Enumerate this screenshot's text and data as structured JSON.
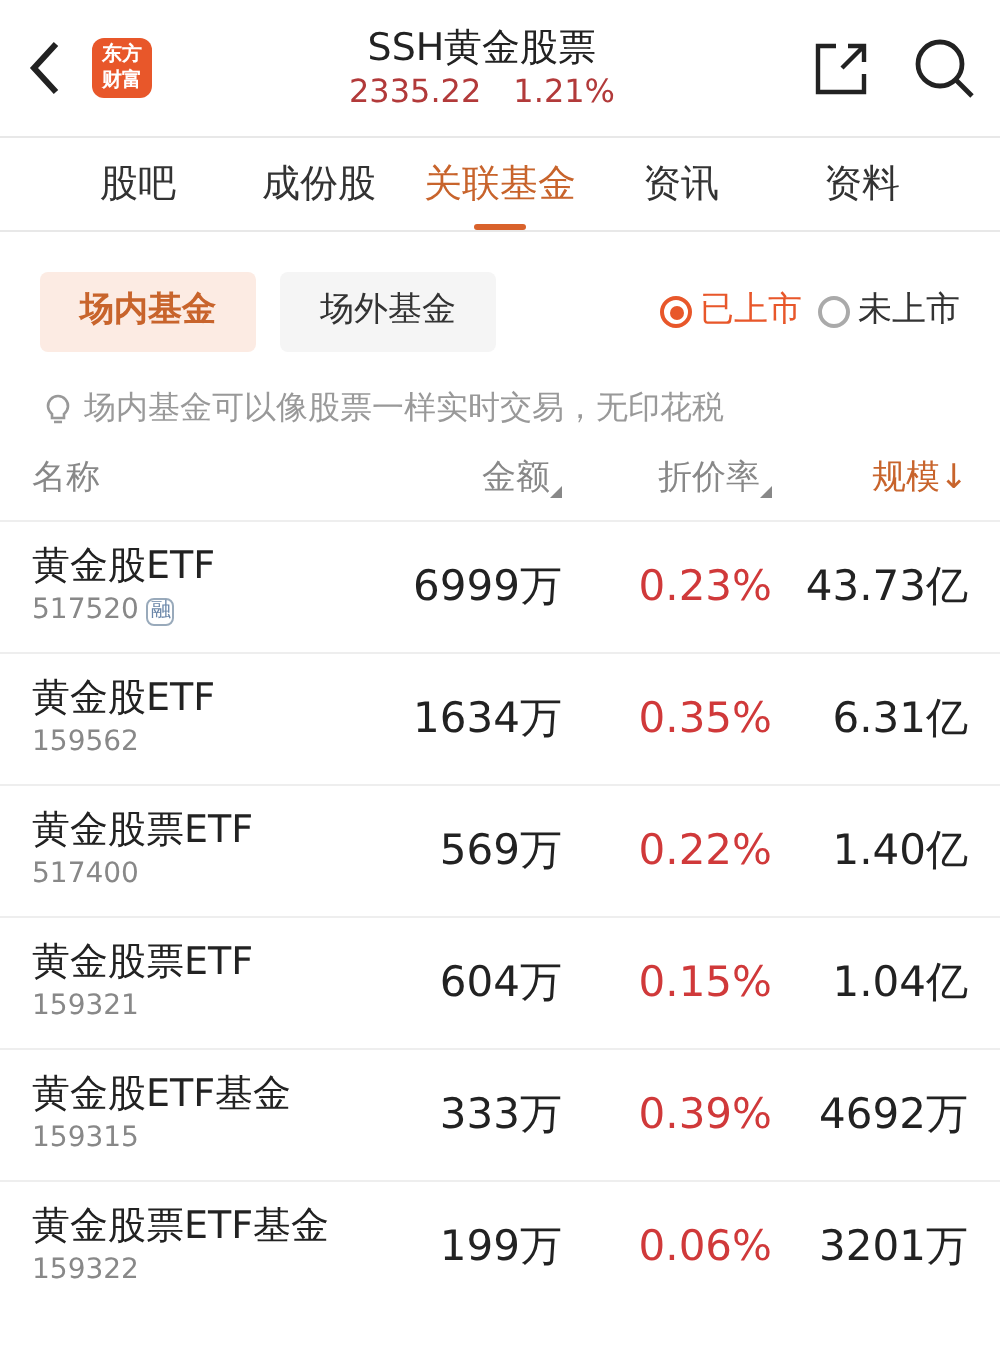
{
  "header": {
    "logo": [
      "东方",
      "财富"
    ],
    "title": "SSH黄金股票",
    "price": "2335.22",
    "change": "1.21%"
  },
  "tabs": [
    {
      "label": "股吧",
      "selected": false
    },
    {
      "label": "成份股",
      "selected": false
    },
    {
      "label": "关联基金",
      "selected": true
    },
    {
      "label": "资讯",
      "selected": false
    },
    {
      "label": "资料",
      "selected": false
    }
  ],
  "segments": [
    {
      "label": "场内基金",
      "selected": true
    },
    {
      "label": "场外基金",
      "selected": false
    }
  ],
  "listing_filter": [
    {
      "label": "已上市",
      "selected": true
    },
    {
      "label": "未上市",
      "selected": false
    }
  ],
  "hint": "场内基金可以像股票一样实时交易，无印花税",
  "table": {
    "columns": [
      {
        "label": "名称",
        "sortable": false,
        "selected": false
      },
      {
        "label": "金额",
        "sortable": true,
        "selected": false
      },
      {
        "label": "折价率",
        "sortable": true,
        "selected": false
      },
      {
        "label": "规模↓",
        "sortable": false,
        "selected": true
      }
    ],
    "rows": [
      {
        "name": "黄金股ETF",
        "code": "517520",
        "badge": "融",
        "amount": "6999万",
        "discount": "0.23%",
        "scale": "43.73亿"
      },
      {
        "name": "黄金股ETF",
        "code": "159562",
        "amount": "1634万",
        "discount": "0.35%",
        "scale": "6.31亿"
      },
      {
        "name": "黄金股票ETF",
        "code": "517400",
        "amount": "569万",
        "discount": "0.22%",
        "scale": "1.40亿"
      },
      {
        "name": "黄金股票ETF",
        "code": "159321",
        "amount": "604万",
        "discount": "0.15%",
        "scale": "1.04亿"
      },
      {
        "name": "黄金股ETF基金",
        "code": "159315",
        "amount": "333万",
        "discount": "0.39%",
        "scale": "4692万"
      },
      {
        "name": "黄金股票ETF基金",
        "code": "159322",
        "amount": "199万",
        "discount": "0.06%",
        "scale": "3201万"
      }
    ]
  }
}
